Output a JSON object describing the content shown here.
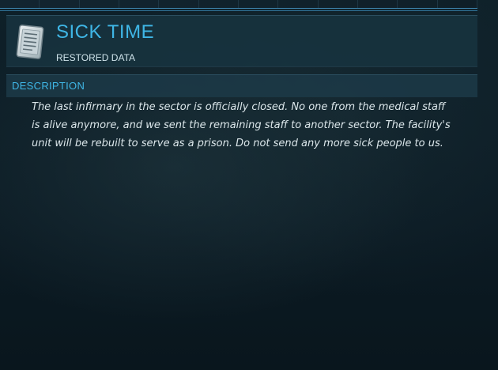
{
  "entry": {
    "title": "SICK TIME",
    "subtitle": "RESTORED DATA",
    "icon": "document-icon"
  },
  "description": {
    "label": "DESCRIPTION",
    "text": "The last infirmary in the sector is officially closed. No one from the medical staff is alive anymore, and we sent the remaining staff to another sector. The facility's unit will be rebuilt to serve as a prison. Do not send any more sick people to us."
  },
  "colors": {
    "accent": "#3fb6e6",
    "panel": "#183440",
    "background": "#0b1a22",
    "text": "#dbe6ea"
  }
}
